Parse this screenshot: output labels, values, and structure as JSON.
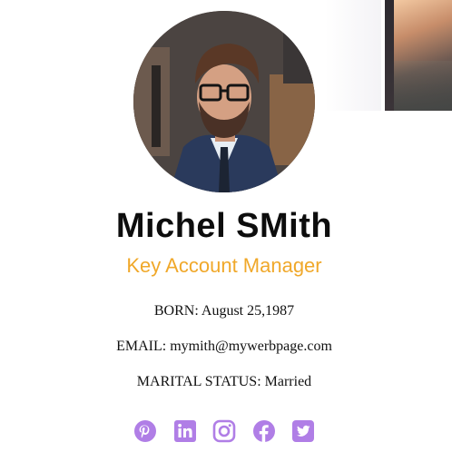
{
  "profile": {
    "name": "Michel SMith",
    "role": "Key Account Manager",
    "born": "BORN: August 25,1987",
    "email": "EMAIL: mymith@mywerbpage.com",
    "marital_status": "MARITAL STATUS: Married"
  },
  "social": {
    "icons": [
      "pinterest-icon",
      "linkedin-icon",
      "instagram-icon",
      "facebook-icon",
      "twitter-icon"
    ],
    "color": "#b07ee6"
  },
  "colors": {
    "name": "#0d0d0d",
    "role": "#f0a82a"
  }
}
